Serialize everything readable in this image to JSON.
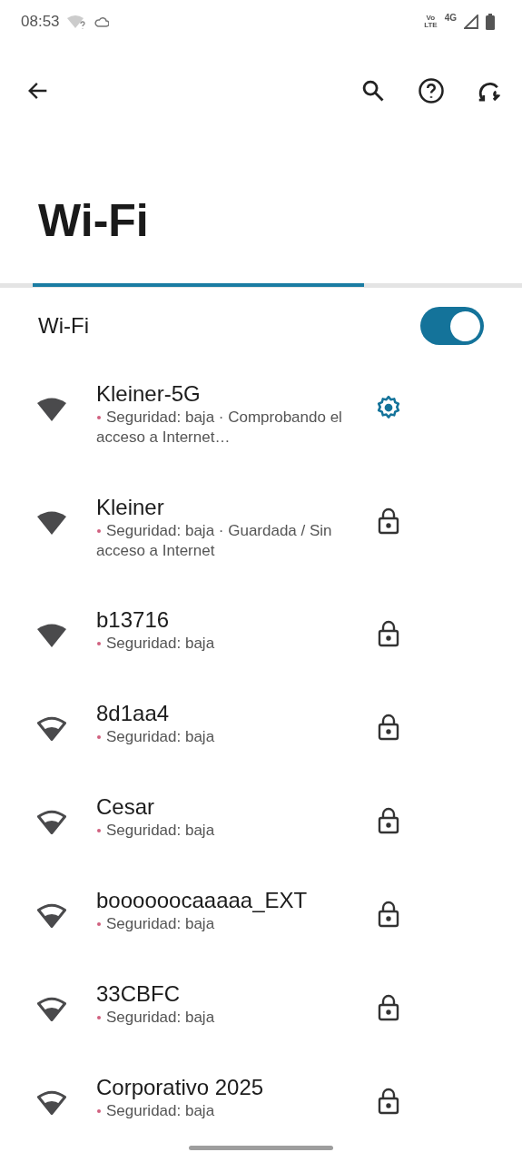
{
  "status_bar": {
    "time": "08:53",
    "network": "Vo\nLTE",
    "mobile": "4G"
  },
  "title": "Wi-Fi",
  "wifi_toggle": {
    "label": "Wi-Fi",
    "on": true
  },
  "networks": [
    {
      "name": "Kleiner-5G",
      "details": "Seguridad: baja · Comprobando el acceso a Internet…",
      "kind": "strong",
      "connected": true
    },
    {
      "name": "Kleiner",
      "details": "Seguridad: baja · Guardada / Sin acceso a Internet",
      "kind": "strong",
      "connected": false
    },
    {
      "name": "b13716",
      "details": "Seguridad: baja",
      "kind": "strong",
      "connected": false
    },
    {
      "name": "8d1aa4",
      "details": "Seguridad: baja",
      "kind": "fair",
      "connected": false
    },
    {
      "name": "Cesar",
      "details": "Seguridad: baja",
      "kind": "fair",
      "connected": false
    },
    {
      "name": "boooooocaaaaa_EXT",
      "details": "Seguridad: baja",
      "kind": "fair",
      "connected": false
    },
    {
      "name": "33CBFC",
      "details": "Seguridad: baja",
      "kind": "fair",
      "connected": false
    },
    {
      "name": "Corporativo 2025",
      "details": "Seguridad: baja",
      "kind": "fair",
      "connected": false
    }
  ]
}
